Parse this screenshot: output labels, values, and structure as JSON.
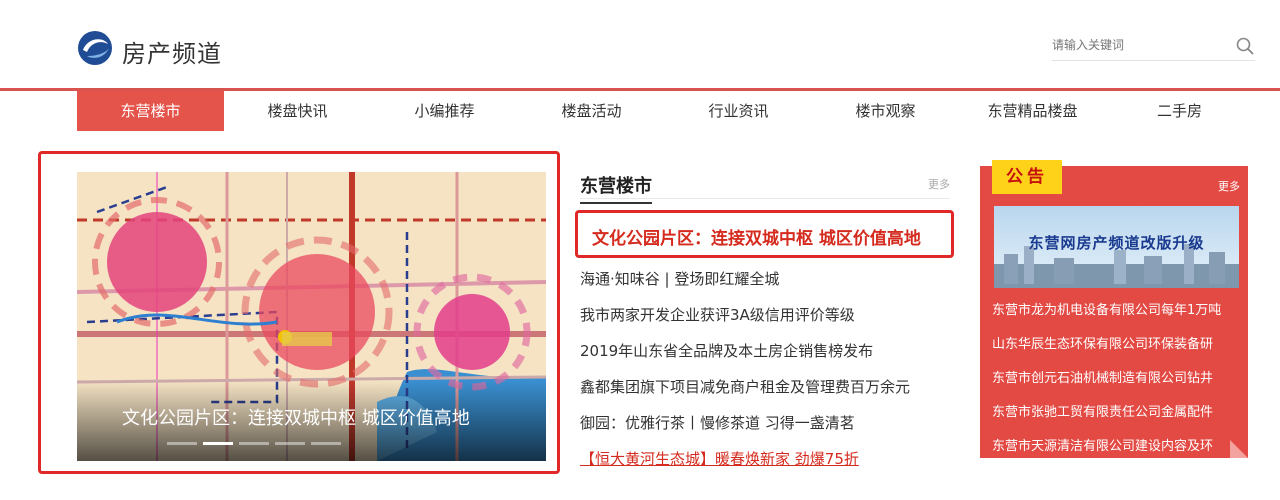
{
  "header": {
    "site_title": "房产频道",
    "logo_icon": "swirl-logo-icon",
    "search_placeholder": "请输入关键词",
    "search_icon": "search-icon"
  },
  "nav": {
    "items": [
      {
        "label": "东营楼市",
        "active": true
      },
      {
        "label": "楼盘快讯"
      },
      {
        "label": "小编推荐"
      },
      {
        "label": "楼盘活动"
      },
      {
        "label": "行业资讯"
      },
      {
        "label": "楼市观察"
      },
      {
        "label": "东营精品楼盘"
      },
      {
        "label": "二手房"
      }
    ]
  },
  "hero": {
    "caption": "文化公园片区：连接双城中枢 城区价值高地",
    "slides": 5,
    "active_slide": 2
  },
  "news": {
    "section_title": "东营楼市",
    "more_label": "更多",
    "headline": "文化公园片区：连接双城中枢 城区价值高地",
    "items": [
      "海通·知味谷 | 登场即红耀全城",
      "我市两家开发企业获评3A级信用评价等级",
      "2019年山东省全品牌及本土房企销售榜发布",
      "鑫都集团旗下项目减免商户租金及管理费百万余元",
      "御园：优雅行茶丨慢修茶道 习得一盏清茗",
      "【恒大黄河生态城】暖春焕新家 劲爆75折"
    ]
  },
  "notice": {
    "tab_label": "公告",
    "more_label": "更多",
    "banner_text": "东营网房产频道改版升级",
    "items": [
      "东营市龙为机电设备有限公司每年1万吨",
      "山东华辰生态环保有限公司环保装备研",
      "东营市创元石油机械制造有限公司钻井",
      "东营市张驰工贸有限责任公司金属配件",
      "东营市天源清洁有限公司建设内容及环"
    ]
  },
  "colors": {
    "accent_red": "#e4544b",
    "frame_red": "#e02828",
    "notice_red": "#e34a44",
    "notice_yellow": "#ffd21a"
  }
}
